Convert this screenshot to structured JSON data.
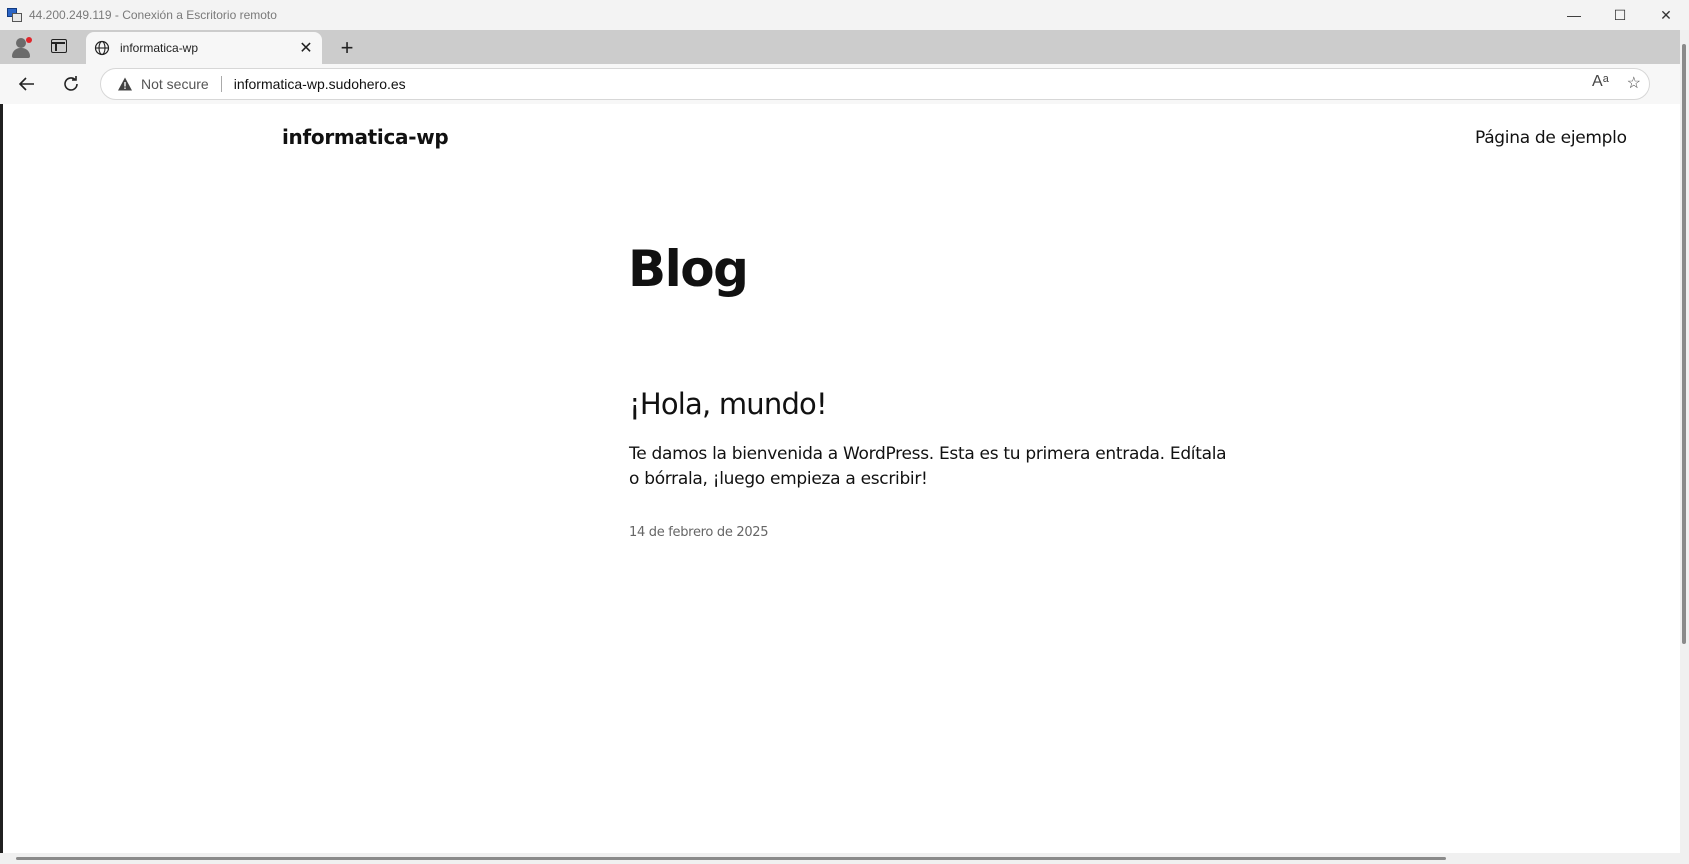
{
  "window": {
    "title": "44.200.249.119 - Conexión a Escritorio remoto",
    "controls": {
      "minimize": "—",
      "maximize": "☐",
      "close": "✕"
    }
  },
  "browser": {
    "tab": {
      "title": "informatica-wp",
      "icon": "globe-icon"
    },
    "new_tab": "+",
    "address": {
      "security_label": "Not secure",
      "url": "informatica-wp.sudohero.es"
    },
    "icons": {
      "read_aloud": "Aᵃ",
      "favorite": "☆"
    }
  },
  "site": {
    "title": "informatica-wp",
    "nav": [
      {
        "label": "Página de ejemplo"
      }
    ],
    "heading": "Blog",
    "posts": [
      {
        "title": "¡Hola, mundo!",
        "excerpt": "Te damos la bienvenida a WordPress. Esta es tu primera entrada. Edítala o bórrala, ¡luego empieza a escribir!",
        "date": "14 de febrero de 2025"
      }
    ]
  }
}
